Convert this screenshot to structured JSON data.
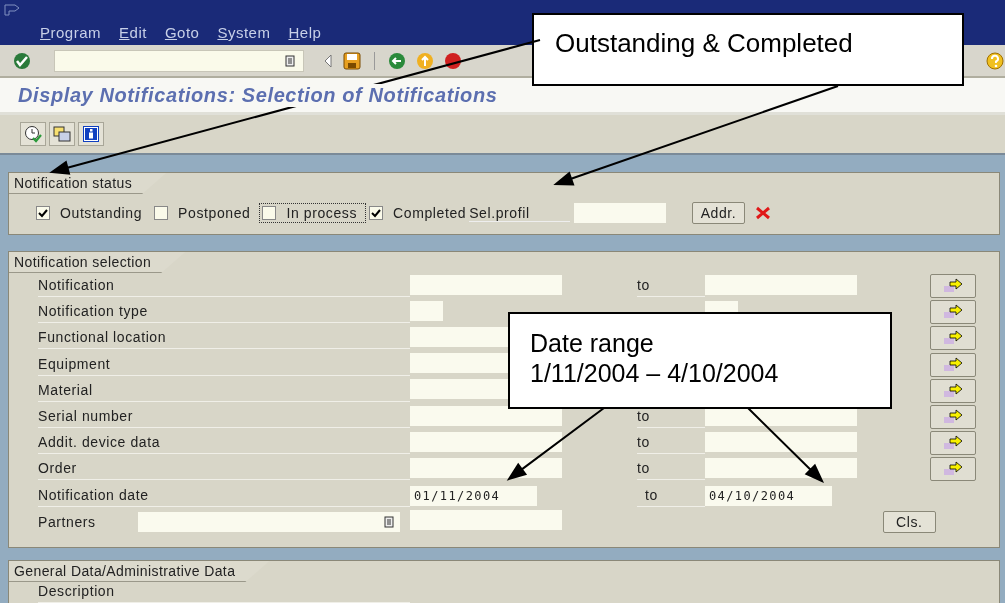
{
  "menu": [
    {
      "label": "Program"
    },
    {
      "label": "Edit"
    },
    {
      "label": "Goto"
    },
    {
      "label": "System"
    },
    {
      "label": "Help"
    }
  ],
  "title": "Display Notifications: Selection of Notifications",
  "status_group": {
    "title": "Notification status",
    "checkboxes": [
      {
        "label": "Outstanding",
        "checked": true,
        "focused": false
      },
      {
        "label": "Postponed",
        "checked": false,
        "focused": false
      },
      {
        "label": "In process",
        "checked": false,
        "focused": true
      },
      {
        "label": "Completed",
        "checked": true,
        "focused": false
      }
    ],
    "profile_label": "Sel.profil",
    "address_button": "Addr."
  },
  "selection_group": {
    "title": "Notification selection",
    "rows": [
      {
        "label": "Notification",
        "to": "to",
        "kind": "range",
        "more": true
      },
      {
        "label": "Notification type",
        "kind": "code",
        "more": true
      },
      {
        "label": "Functional location",
        "kind": "from",
        "more": true
      },
      {
        "label": "Equipment",
        "kind": "from",
        "more": true
      },
      {
        "label": "Material",
        "kind": "from",
        "more": true
      },
      {
        "label": "Serial number",
        "to": "to",
        "kind": "range",
        "more": true
      },
      {
        "label": "Addit. device data",
        "to": "to",
        "kind": "range",
        "more": true
      },
      {
        "label": "Order",
        "to": "to",
        "kind": "range",
        "more": true
      },
      {
        "label": "Notification date",
        "to": "to",
        "kind": "date",
        "from_value": "01/11/2004",
        "to_value": "04/10/2004",
        "more": false
      },
      {
        "label": "Partners",
        "kind": "partner",
        "button": "Cls."
      }
    ]
  },
  "admin_group": {
    "title": "General Data/Administrative Data",
    "rows": [
      {
        "label": "Description"
      }
    ]
  },
  "callouts": [
    {
      "lines": [
        "Outstanding & Completed"
      ]
    },
    {
      "lines": [
        "Date range",
        "1/11/2004 – 4/10/2004"
      ]
    }
  ]
}
